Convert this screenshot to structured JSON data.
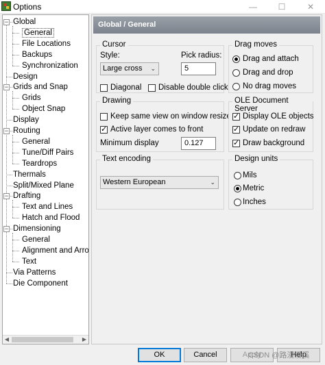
{
  "window": {
    "title": "Options",
    "minimize": "—",
    "maximize": "☐",
    "close": "✕"
  },
  "tree": {
    "items": [
      {
        "label": "Global",
        "level": 0
      },
      {
        "label": "General",
        "level": 1,
        "selected": true
      },
      {
        "label": "File Locations",
        "level": 1
      },
      {
        "label": "Backups",
        "level": 1
      },
      {
        "label": "Synchronization",
        "level": 1
      },
      {
        "label": "Design",
        "level": 0
      },
      {
        "label": "Grids and Snap",
        "level": 0
      },
      {
        "label": "Grids",
        "level": 1
      },
      {
        "label": "Object Snap",
        "level": 1
      },
      {
        "label": "Display",
        "level": 0
      },
      {
        "label": "Routing",
        "level": 0
      },
      {
        "label": "General",
        "level": 1
      },
      {
        "label": "Tune/Diff Pairs",
        "level": 1
      },
      {
        "label": "Teardrops",
        "level": 1
      },
      {
        "label": "Thermals",
        "level": 0
      },
      {
        "label": "Split/Mixed Plane",
        "level": 0
      },
      {
        "label": "Drafting",
        "level": 0
      },
      {
        "label": "Text and Lines",
        "level": 1
      },
      {
        "label": "Hatch and Flood",
        "level": 1
      },
      {
        "label": "Dimensioning",
        "level": 0
      },
      {
        "label": "General",
        "level": 1
      },
      {
        "label": "Alignment and Arro",
        "level": 1
      },
      {
        "label": "Text",
        "level": 1
      },
      {
        "label": "Via Patterns",
        "level": 0
      },
      {
        "label": "Die Component",
        "level": 0
      }
    ]
  },
  "panel": {
    "header": "Global / General",
    "cursor": {
      "title": "Cursor",
      "style_label": "Style:",
      "style_value": "Large cross",
      "pick_radius_label": "Pick radius:",
      "pick_radius_value": "5",
      "diagonal_label": "Diagonal",
      "diagonal_checked": false,
      "disable_double_click_label": "Disable double click",
      "disable_double_click_checked": false
    },
    "drag_moves": {
      "title": "Drag moves",
      "options": [
        "Drag and attach",
        "Drag and drop",
        "No drag moves"
      ],
      "selected": "Drag and attach"
    },
    "drawing": {
      "title": "Drawing",
      "keep_same_view_label": "Keep same view on window resize",
      "keep_same_view_checked": false,
      "active_layer_label": "Active layer comes to front",
      "active_layer_checked": true,
      "minimum_display_label": "Minimum display",
      "minimum_display_value": "0.127"
    },
    "ole": {
      "title": "OLE Document Server",
      "display_ole_label": "Display OLE objects",
      "display_ole_checked": true,
      "update_on_redraw_label": "Update on redraw",
      "update_on_redraw_checked": true,
      "draw_background_label": "Draw background",
      "draw_background_checked": true
    },
    "text_encoding": {
      "title": "Text encoding",
      "value": "Western European"
    },
    "design_units": {
      "title": "Design units",
      "options": [
        "Mils",
        "Metric",
        "Inches"
      ],
      "selected": "Metric"
    }
  },
  "buttons": {
    "ok": "OK",
    "cancel": "Cancel",
    "apply": "Apply",
    "help": "Help"
  },
  "watermark": "CSDN @路漫漫溪",
  "colors": {
    "header_bg": "#8a9099",
    "focus_border": "#0078d7"
  }
}
